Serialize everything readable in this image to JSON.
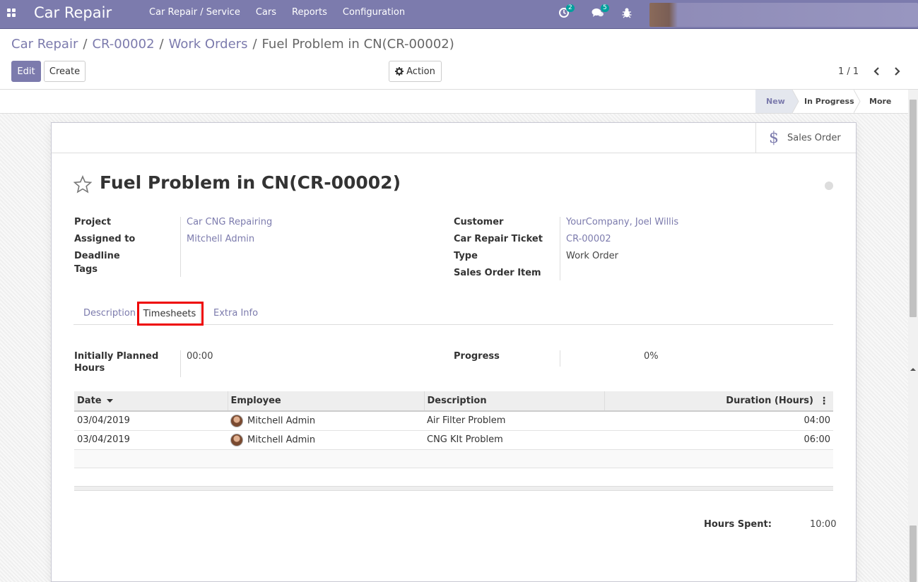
{
  "navbar": {
    "app_name": "Car Repair",
    "menu": [
      "Car Repair / Service",
      "Cars",
      "Reports",
      "Configuration"
    ],
    "activity_count": "2",
    "message_count": "5",
    "color": "#7c7bad"
  },
  "breadcrumb": {
    "items": [
      "Car Repair",
      "CR-00002",
      "Work Orders"
    ],
    "separator": "/",
    "current": "Fuel Problem in CN(CR-00002)"
  },
  "toolbar": {
    "edit_label": "Edit",
    "create_label": "Create",
    "action_label": "Action",
    "pager": "1 / 1"
  },
  "statusbar": {
    "stages": [
      "New",
      "In Progress"
    ],
    "current_stage": "New",
    "more_label": "More"
  },
  "smart_buttons": {
    "sales_order_label": "Sales Order"
  },
  "record": {
    "title": "Fuel Problem in CN(CR-00002)",
    "left_fields": [
      {
        "label": "Project",
        "value": "Car CNG Repairing",
        "link": true
      },
      {
        "label": "Assigned to",
        "value": "Mitchell Admin",
        "link": true
      },
      {
        "label": "Deadline",
        "value": "",
        "link": false
      },
      {
        "label": "Tags",
        "value": "",
        "link": false
      }
    ],
    "right_fields": [
      {
        "label": "Customer",
        "value": "YourCompany, Joel Willis",
        "link": true
      },
      {
        "label": "Car Repair Ticket",
        "value": "CR-00002",
        "link": true
      },
      {
        "label": "Type",
        "value": "Work Order",
        "link": false
      },
      {
        "label": "Sales Order Item",
        "value": "",
        "link": false
      }
    ]
  },
  "tabs": {
    "items": [
      "Description",
      "Timesheets",
      "Extra Info"
    ],
    "active": "Timesheets"
  },
  "timesheets": {
    "planned_label_1": "Initially Planned",
    "planned_label_2": "Hours",
    "planned_value": "00:00",
    "progress_label": "Progress",
    "progress_value": "0%",
    "columns": [
      "Date",
      "Employee",
      "Description",
      "Duration (Hours)"
    ],
    "rows": [
      {
        "date": "03/04/2019",
        "employee": "Mitchell Admin",
        "description": "Air Filter Problem",
        "duration": "04:00"
      },
      {
        "date": "03/04/2019",
        "employee": "Mitchell Admin",
        "description": "CNG KIt Problem",
        "duration": "06:00"
      }
    ],
    "hours_spent_label": "Hours Spent:",
    "hours_spent_value": "10:00"
  }
}
